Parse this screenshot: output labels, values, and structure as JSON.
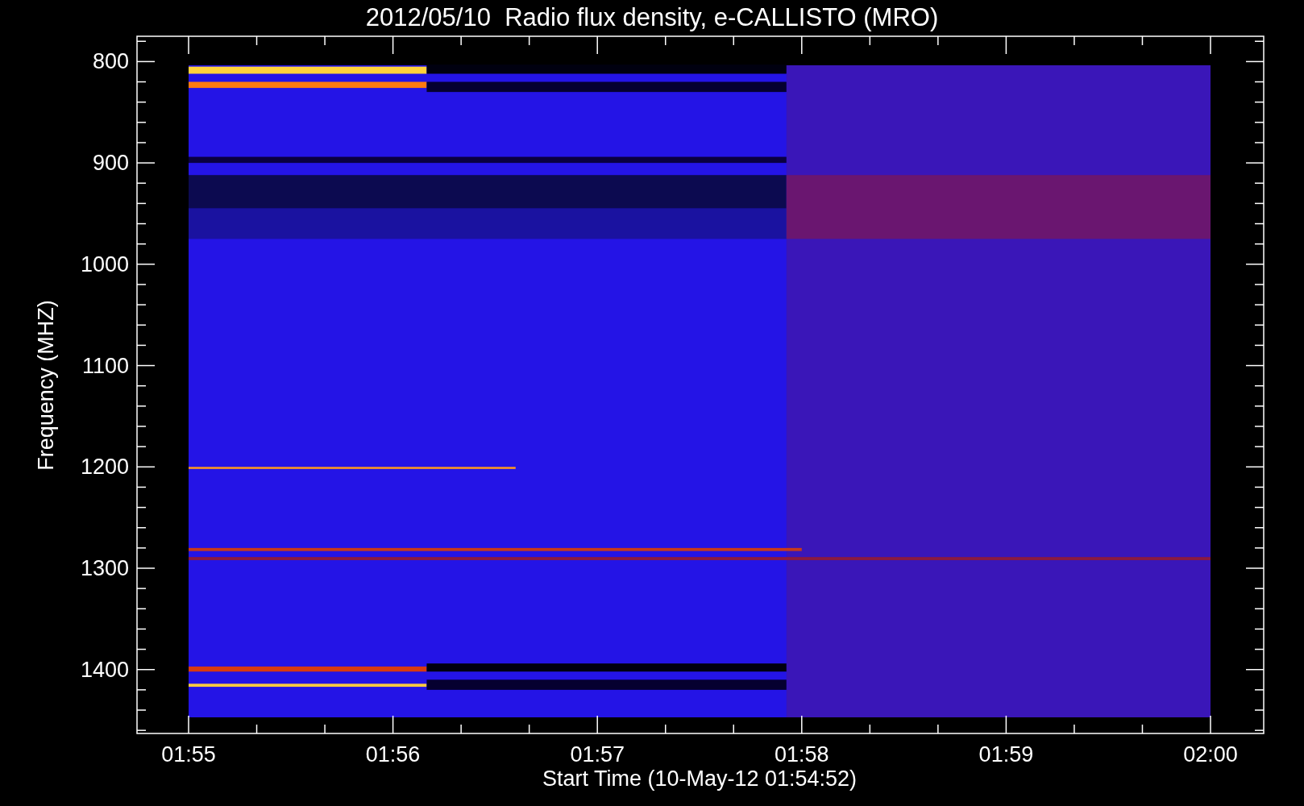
{
  "chart": {
    "title": "2012/05/10  Radio flux density, e-CALLISTO (MRO)",
    "xlabel": "Start Time (10-May-12 01:54:52)",
    "ylabel": "Frequency (MHZ)",
    "xticks": [
      "01:55",
      "01:56",
      "01:57",
      "01:58",
      "01:59",
      "02:00"
    ],
    "yticks": [
      "800",
      "900",
      "1000",
      "1100",
      "1200",
      "1300",
      "1400"
    ]
  }
}
